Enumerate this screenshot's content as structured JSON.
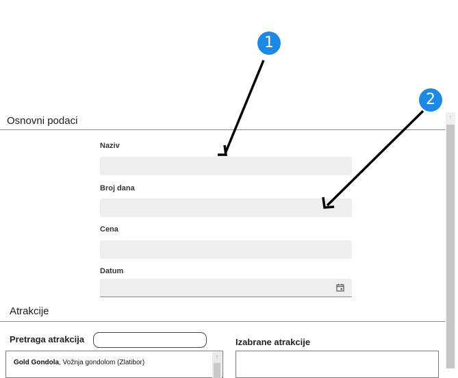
{
  "sections": {
    "basic": "Osnovni podaci",
    "attractions": "Atrakcije"
  },
  "fields": [
    {
      "label": "Naziv",
      "value": ""
    },
    {
      "label": "Broj dana",
      "value": ""
    },
    {
      "label": "Cena",
      "value": ""
    },
    {
      "label": "Datum",
      "value": ""
    }
  ],
  "search": {
    "label": "Pretraga atrakcija",
    "value": ""
  },
  "selected": {
    "label": "Izabrane atrakcije"
  },
  "attraction_list": [
    {
      "name": "Gold Gondola",
      "desc": ", Vožnja gondolom (Zlatibor)"
    }
  ],
  "callouts": [
    "1",
    "2"
  ],
  "icons": {
    "calendar": "calendar-icon",
    "scroll_up": "arrow-up-icon"
  },
  "colors": {
    "callout": "#1e88e5",
    "input_bg": "#eeeeee"
  }
}
